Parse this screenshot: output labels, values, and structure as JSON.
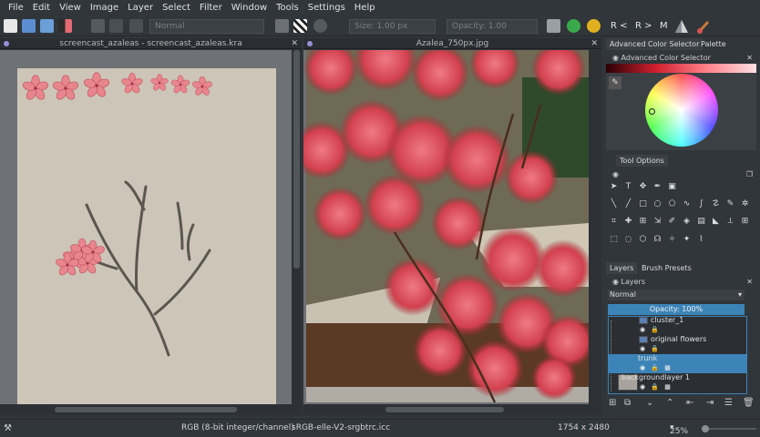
{
  "menubar": [
    "File",
    "Edit",
    "View",
    "Image",
    "Layer",
    "Select",
    "Filter",
    "Window",
    "Tools",
    "Settings",
    "Help"
  ],
  "toolbar": {
    "blend_mode": "Normal",
    "size_label": "Size:",
    "size_value": "1.00 px",
    "opacity_label": "Opacity:",
    "opacity_value": "1.00",
    "mirror_h": "R <",
    "mirror_v": "R >",
    "mirror_m": "M"
  },
  "documents": {
    "left_title": "screencast_azaleas - screencast_azaleas.kra",
    "right_title": "Azalea_750px.jpg"
  },
  "dockers": {
    "top_tabs": [
      "Advanced Color Selector",
      "Palette"
    ],
    "color_selector_title": "Advanced Color Selector",
    "tool_options_title": "Tool Options",
    "bottom_tabs": [
      "Layers",
      "Brush Presets"
    ],
    "layers_title": "Layers",
    "layers_blend_mode": "Normal",
    "layers_opacity": "Opacity:  100%",
    "layers": [
      {
        "name": "cluster_1",
        "selected": false
      },
      {
        "name": "original flowers",
        "selected": false
      },
      {
        "name": "trunk",
        "selected": true
      },
      {
        "name": "backgroundlayer 1",
        "selected": false
      }
    ]
  },
  "status": {
    "color_model": "RGB (8-bit integer/channel)",
    "profile": "sRGB-elle-V2-srgbtrc.icc",
    "dimensions": "1754 x 2480",
    "zoom": "25%"
  },
  "colors": {
    "bg": "#31363b",
    "selection": "#3c84b8",
    "canvas": "#cdc6b8",
    "flower": "#e8868e"
  }
}
